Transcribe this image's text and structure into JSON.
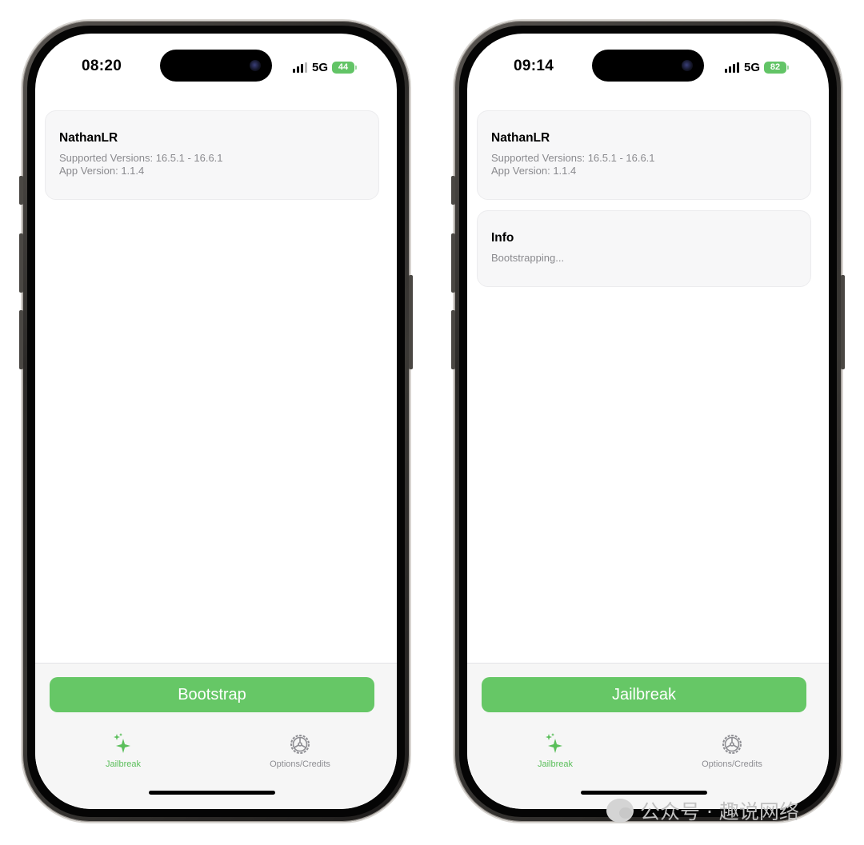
{
  "phones": [
    {
      "time": "08:20",
      "network": "5G",
      "battery": "44",
      "card": {
        "title": "NathanLR",
        "supported": "Supported Versions: 16.5.1 - 16.6.1",
        "app_version": "App Version: 1.1.4"
      },
      "action_button": "Bootstrap",
      "tabs": [
        {
          "label": "Jailbreak",
          "icon": "sparkles-icon",
          "active": true
        },
        {
          "label": "Options/Credits",
          "icon": "gear-icon",
          "active": false
        }
      ]
    },
    {
      "time": "09:14",
      "network": "5G",
      "battery": "82",
      "card": {
        "title": "NathanLR",
        "supported": "Supported Versions: 16.5.1 - 16.6.1",
        "app_version": "App Version: 1.1.4"
      },
      "info_card": {
        "title": "Info",
        "message": "Bootstrapping..."
      },
      "action_button": "Jailbreak",
      "tabs": [
        {
          "label": "Jailbreak",
          "icon": "sparkles-icon",
          "active": true
        },
        {
          "label": "Options/Credits",
          "icon": "gear-icon",
          "active": false
        }
      ]
    }
  ],
  "colors": {
    "accent_green": "#66c766",
    "tab_active": "#5bbf5b",
    "tab_inactive": "#8e8e93",
    "battery_green": "#62c466"
  },
  "watermark": "公众号 · 趣说网络"
}
